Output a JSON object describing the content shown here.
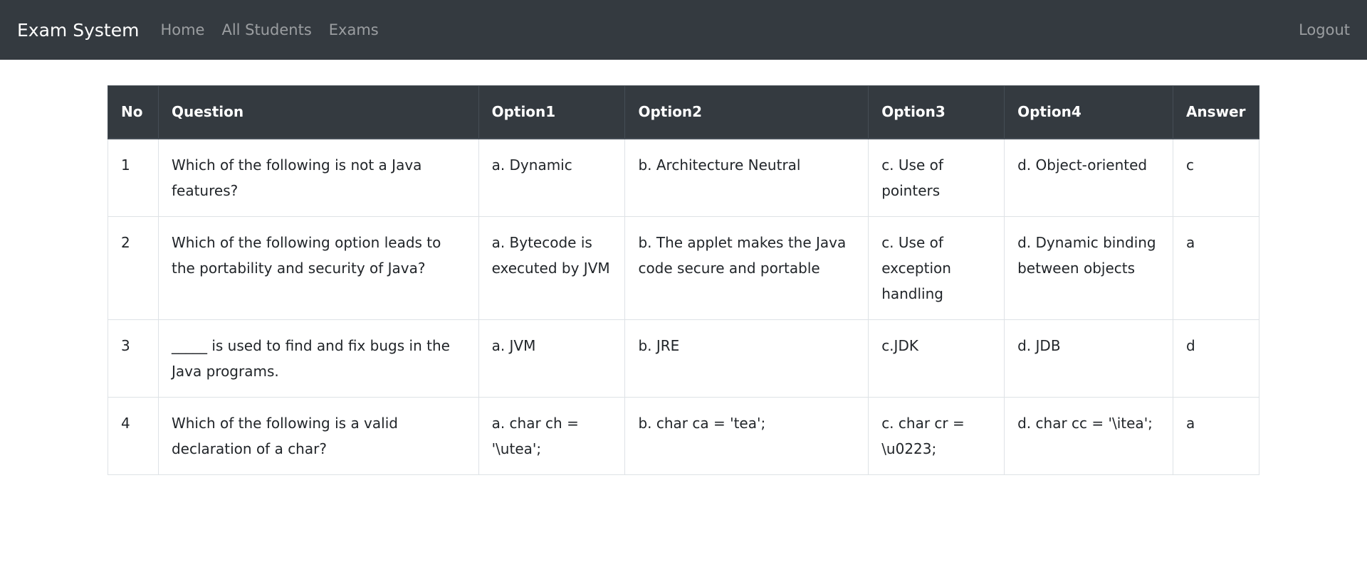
{
  "navbar": {
    "brand": "Exam System",
    "links": [
      "Home",
      "All Students",
      "Exams"
    ],
    "logout": "Logout"
  },
  "table": {
    "headers": [
      "No",
      "Question",
      "Option1",
      "Option2",
      "Option3",
      "Option4",
      "Answer"
    ],
    "rows": [
      [
        "1",
        "Which of the following is not a Java features?",
        "a. Dynamic",
        "b. Architecture Neutral",
        "c. Use of pointers",
        "d. Object-oriented",
        "c"
      ],
      [
        "2",
        "Which of the following option leads to the portability and security of Java?",
        "a. Bytecode is executed by JVM",
        "b. The applet makes the Java code secure and portable",
        "c. Use of exception handling",
        "d. Dynamic binding between objects",
        "a"
      ],
      [
        "3",
        "_____ is used to find and fix bugs in the Java programs.",
        "a. JVM",
        "b. JRE",
        "c.JDK",
        "d. JDB",
        "d"
      ],
      [
        "4",
        "Which of the following is a valid declaration of a char?",
        "a. char ch = '\\utea';",
        "b. char ca = 'tea';",
        "c. char cr = \\u0223;",
        "d. char cc = '\\itea';",
        "a"
      ]
    ]
  }
}
